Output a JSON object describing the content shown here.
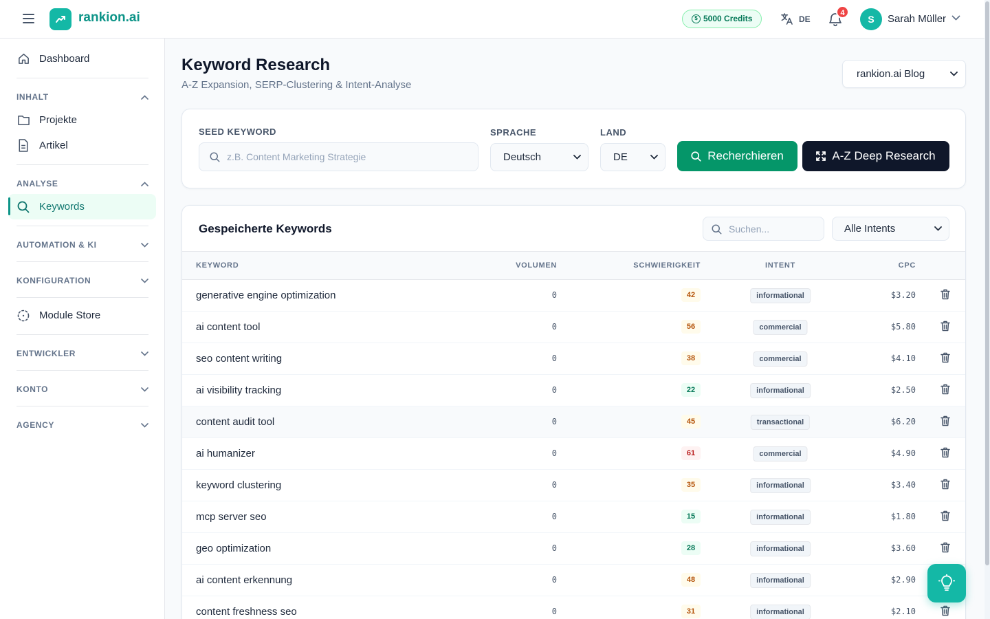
{
  "brand": {
    "name": "rankion.ai"
  },
  "header": {
    "credits": "5000 Credits",
    "language": "DE",
    "notifications_count": "4",
    "user_initial": "S",
    "user_name": "Sarah Müller"
  },
  "sidebar": {
    "dashboard": "Dashboard",
    "sections": {
      "inhalt": "INHALT",
      "analyse": "ANALYSE",
      "automation": "AUTOMATION & KI",
      "konfiguration": "KONFIGURATION",
      "entwickler": "ENTWICKLER",
      "konto": "KONTO",
      "agency": "AGENCY"
    },
    "items": {
      "projekte": "Projekte",
      "artikel": "Artikel",
      "keywords": "Keywords",
      "module_store": "Module Store"
    }
  },
  "page": {
    "title": "Keyword Research",
    "subtitle": "A-Z Expansion, SERP-Clustering & Intent-Analyse",
    "project_selected": "rankion.ai Blog"
  },
  "research": {
    "seed_label": "SEED KEYWORD",
    "seed_placeholder": "z.B. Content Marketing Strategie",
    "language_label": "SPRACHE",
    "language_value": "Deutsch",
    "country_label": "LAND",
    "country_value": "DE",
    "search_button": "Recherchieren",
    "deep_button": "A-Z Deep Research"
  },
  "saved": {
    "title": "Gespeicherte Keywords",
    "search_placeholder": "Suchen...",
    "intent_filter": "Alle Intents",
    "columns": {
      "keyword": "KEYWORD",
      "volume": "VOLUMEN",
      "difficulty": "SCHWIERIGKEIT",
      "intent": "INTENT",
      "cpc": "CPC"
    },
    "rows": [
      {
        "keyword": "generative engine optimization",
        "volume": "0",
        "difficulty": "42",
        "intent": "informational",
        "cpc": "$3.20"
      },
      {
        "keyword": "ai content tool",
        "volume": "0",
        "difficulty": "56",
        "intent": "commercial",
        "cpc": "$5.80"
      },
      {
        "keyword": "seo content writing",
        "volume": "0",
        "difficulty": "38",
        "intent": "commercial",
        "cpc": "$4.10"
      },
      {
        "keyword": "ai visibility tracking",
        "volume": "0",
        "difficulty": "22",
        "intent": "informational",
        "cpc": "$2.50"
      },
      {
        "keyword": "content audit tool",
        "volume": "0",
        "difficulty": "45",
        "intent": "transactional",
        "cpc": "$6.20"
      },
      {
        "keyword": "ai humanizer",
        "volume": "0",
        "difficulty": "61",
        "intent": "commercial",
        "cpc": "$4.90"
      },
      {
        "keyword": "keyword clustering",
        "volume": "0",
        "difficulty": "35",
        "intent": "informational",
        "cpc": "$3.40"
      },
      {
        "keyword": "mcp server seo",
        "volume": "0",
        "difficulty": "15",
        "intent": "informational",
        "cpc": "$1.80"
      },
      {
        "keyword": "geo optimization",
        "volume": "0",
        "difficulty": "28",
        "intent": "informational",
        "cpc": "$3.60"
      },
      {
        "keyword": "ai content erkennung",
        "volume": "0",
        "difficulty": "48",
        "intent": "informational",
        "cpc": "$2.90"
      },
      {
        "keyword": "content freshness seo",
        "volume": "0",
        "difficulty": "31",
        "intent": "informational",
        "cpc": "$2.10"
      }
    ]
  },
  "colors": {
    "brand": "#14b8a6",
    "primary_button": "#059669",
    "dark_button": "#0f172a"
  },
  "icons": {
    "menu": "hamburger-icon",
    "logo": "trend-up-icon",
    "notifications": "bell-icon",
    "delete": "trash-icon",
    "tips": "lightbulb-icon"
  }
}
